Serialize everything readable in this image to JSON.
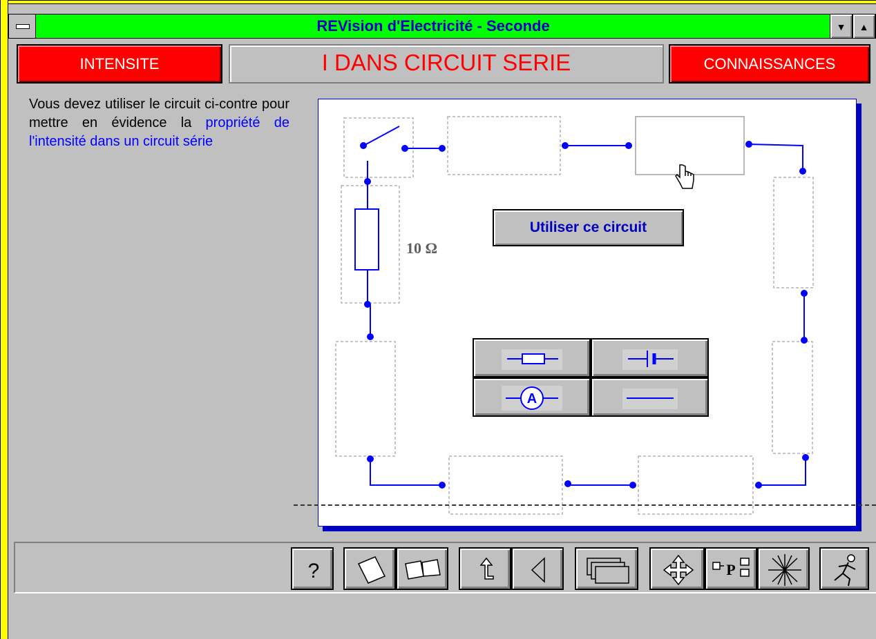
{
  "window": {
    "title": "REVision d'Electricité - Seconde",
    "minimize_glyph": "▼",
    "maximize_glyph": "▲"
  },
  "header": {
    "left_label": "INTENSITE",
    "title": "I DANS CIRCUIT SERIE",
    "right_label": "CONNAISSANCES"
  },
  "instructions": {
    "text_plain": "Vous devez utiliser le circuit ci-contre pour mettre en évidence la",
    "text_highlight": "propriété de l'intensité dans un circuit série",
    "highlight_color": "#0000ff"
  },
  "circuit": {
    "resistor_value": "10 Ω",
    "use_button_label": "Utiliser ce circuit",
    "wire_color": "#0000ff",
    "palette": [
      "resistor-icon",
      "battery-icon",
      "ammeter-icon",
      "wire-icon"
    ],
    "ammeter_letter": "A"
  },
  "toolbar": {
    "help_label": "?",
    "icons": [
      "help-icon",
      "page-icon",
      "book-icon",
      "back-arrow-icon",
      "previous-icon",
      "windows-icon",
      "move-icon",
      "program-icon",
      "spark-icon",
      "exit-runner-icon"
    ]
  },
  "colors": {
    "titlebar": "#00ff00",
    "frame": "#ffff00",
    "header_red": "#ff0000",
    "title_text": "#0000c0"
  }
}
